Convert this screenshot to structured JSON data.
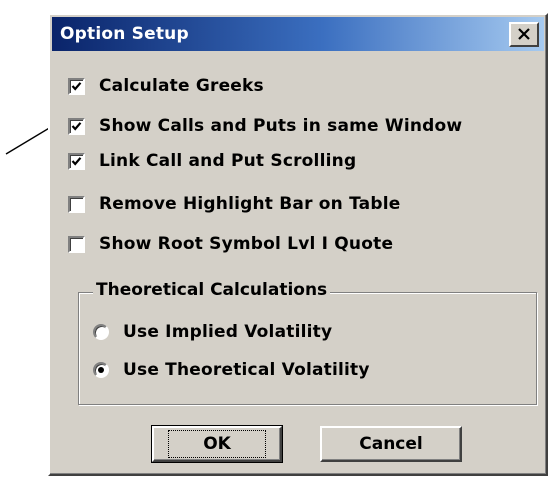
{
  "window": {
    "title": "Option Setup",
    "close_icon": "close-x-icon"
  },
  "options": [
    {
      "label": "Calculate Greeks",
      "checked": true
    },
    {
      "label": "Show Calls and Puts in same Window",
      "checked": true
    },
    {
      "label": "Link Call and Put Scrolling",
      "checked": true
    },
    {
      "label": "Remove Highlight Bar on Table",
      "checked": false
    },
    {
      "label": "Show Root Symbol Lvl I Quote",
      "checked": false
    }
  ],
  "theoretical": {
    "title": "Theoretical Calculations",
    "radios": [
      {
        "label": "Use Implied Volatility",
        "selected": false
      },
      {
        "label": "Use Theoretical Volatility",
        "selected": true
      }
    ]
  },
  "buttons": {
    "ok_label": "OK",
    "cancel_label": "Cancel"
  },
  "colors": {
    "title_start": "#0a246a",
    "title_end": "#a6caf0",
    "face": "#d4d0c8"
  }
}
